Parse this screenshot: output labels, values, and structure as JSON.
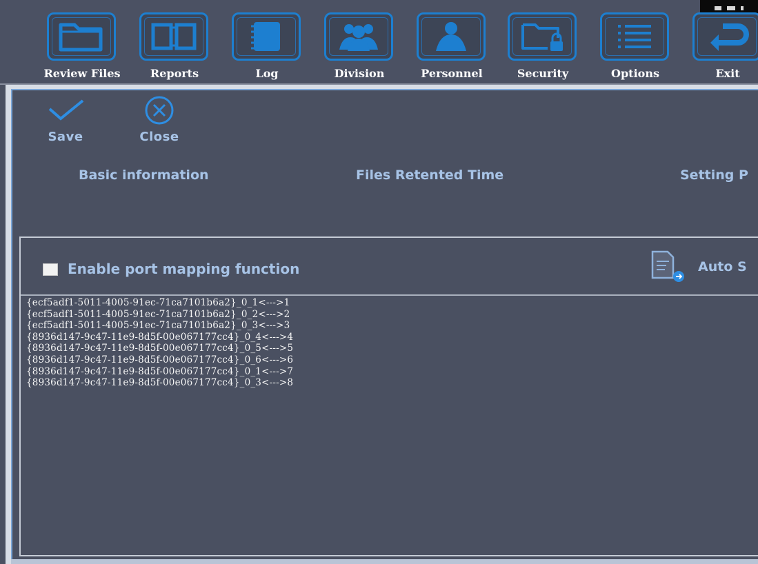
{
  "toolbar": {
    "items": [
      {
        "label": "Review Files",
        "icon": "folder-icon"
      },
      {
        "label": "Reports",
        "icon": "book-icon"
      },
      {
        "label": "Log",
        "icon": "notebook-icon"
      },
      {
        "label": "Division",
        "icon": "group-icon"
      },
      {
        "label": "Personnel",
        "icon": "person-icon"
      },
      {
        "label": "Security",
        "icon": "locked-folder-icon"
      },
      {
        "label": "Options",
        "icon": "list-icon"
      },
      {
        "label": "Exit",
        "icon": "return-arrow-icon"
      }
    ]
  },
  "actions": {
    "save_label": "Save",
    "close_label": "Close"
  },
  "tabs": [
    {
      "label": "Basic information"
    },
    {
      "label": "Files Retented Time"
    },
    {
      "label": "Setting P"
    }
  ],
  "panel": {
    "checkbox_label": "Enable port mapping function",
    "checkbox_checked": false,
    "auto_label": "Auto S"
  },
  "mappings": [
    "{ecf5adf1-5011-4005-91ec-71ca7101b6a2}_0_1<--->1",
    "{ecf5adf1-5011-4005-91ec-71ca7101b6a2}_0_2<--->2",
    "{ecf5adf1-5011-4005-91ec-71ca7101b6a2}_0_3<--->3",
    "{8936d147-9c47-11e9-8d5f-00e067177cc4}_0_4<--->4",
    "{8936d147-9c47-11e9-8d5f-00e067177cc4}_0_5<--->5",
    "{8936d147-9c47-11e9-8d5f-00e067177cc4}_0_6<--->6",
    "{8936d147-9c47-11e9-8d5f-00e067177cc4}_0_1<--->7",
    "{8936d147-9c47-11e9-8d5f-00e067177cc4}_0_3<--->8"
  ],
  "colors": {
    "accent": "#1d7fd0",
    "background": "#4a5061",
    "label": "#a7c3e6"
  }
}
